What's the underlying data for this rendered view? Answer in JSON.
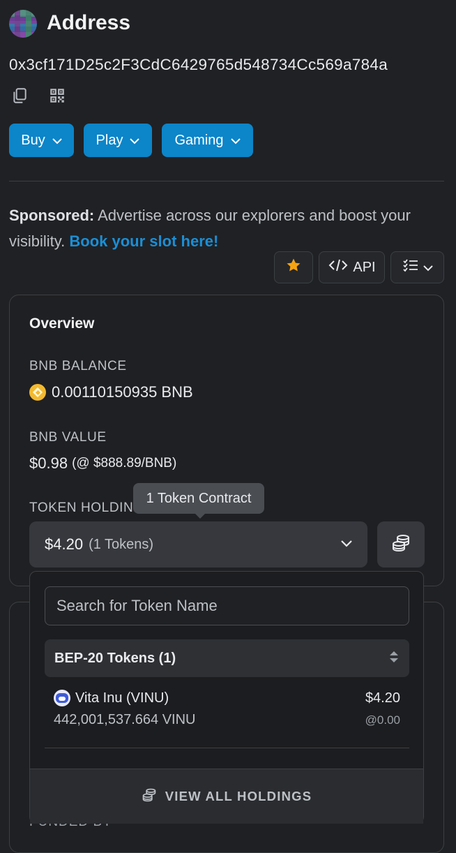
{
  "header": {
    "title": "Address",
    "address": "0x3cf171D25c2F3CdC6429765d548734Cc569a784a"
  },
  "menu_buttons": [
    {
      "label": "Buy"
    },
    {
      "label": "Play"
    },
    {
      "label": "Gaming"
    }
  ],
  "sponsored": {
    "prefix": "Sponsored:",
    "text": " Advertise across our explorers and boost your visibility. ",
    "link": "Book your slot here!"
  },
  "toolbar": {
    "api_label": "API"
  },
  "overview": {
    "heading": "Overview",
    "bnb_balance_label": "BNB BALANCE",
    "bnb_balance_value": "0.00110150935 BNB",
    "bnb_value_label": "BNB VALUE",
    "bnb_value_amount": "$0.98",
    "bnb_value_rate": "(@ $888.89/BNB)",
    "token_holdings_label": "TOKEN HOLDINGS",
    "tooltip": "1 Token Contract",
    "holdings_amount": "$4.20",
    "holdings_count": "(1 Tokens)"
  },
  "token_dropdown": {
    "search_placeholder": "Search for Token Name",
    "group_title": "BEP-20 Tokens (1)",
    "tokens": [
      {
        "name": "Vita Inu (VINU)",
        "quantity": "442,001,537.664 VINU",
        "value": "$4.20",
        "price": "@0.00"
      }
    ],
    "view_all": "VIEW ALL HOLDINGS"
  },
  "funded_by_label": "FUNDED BY",
  "icons": [
    "copy-icon",
    "qr-code-icon",
    "chevron-down-icon",
    "star-icon",
    "code-icon",
    "checklist-icon",
    "coin-stack-icon",
    "sort-icon",
    "bnb-coin-icon",
    "vinu-token-icon"
  ],
  "colors": {
    "accent": "#0c85c9",
    "link": "#1a8fd6",
    "star": "#f6a313",
    "bnb": "#f3ba2f",
    "background": "#202124"
  }
}
